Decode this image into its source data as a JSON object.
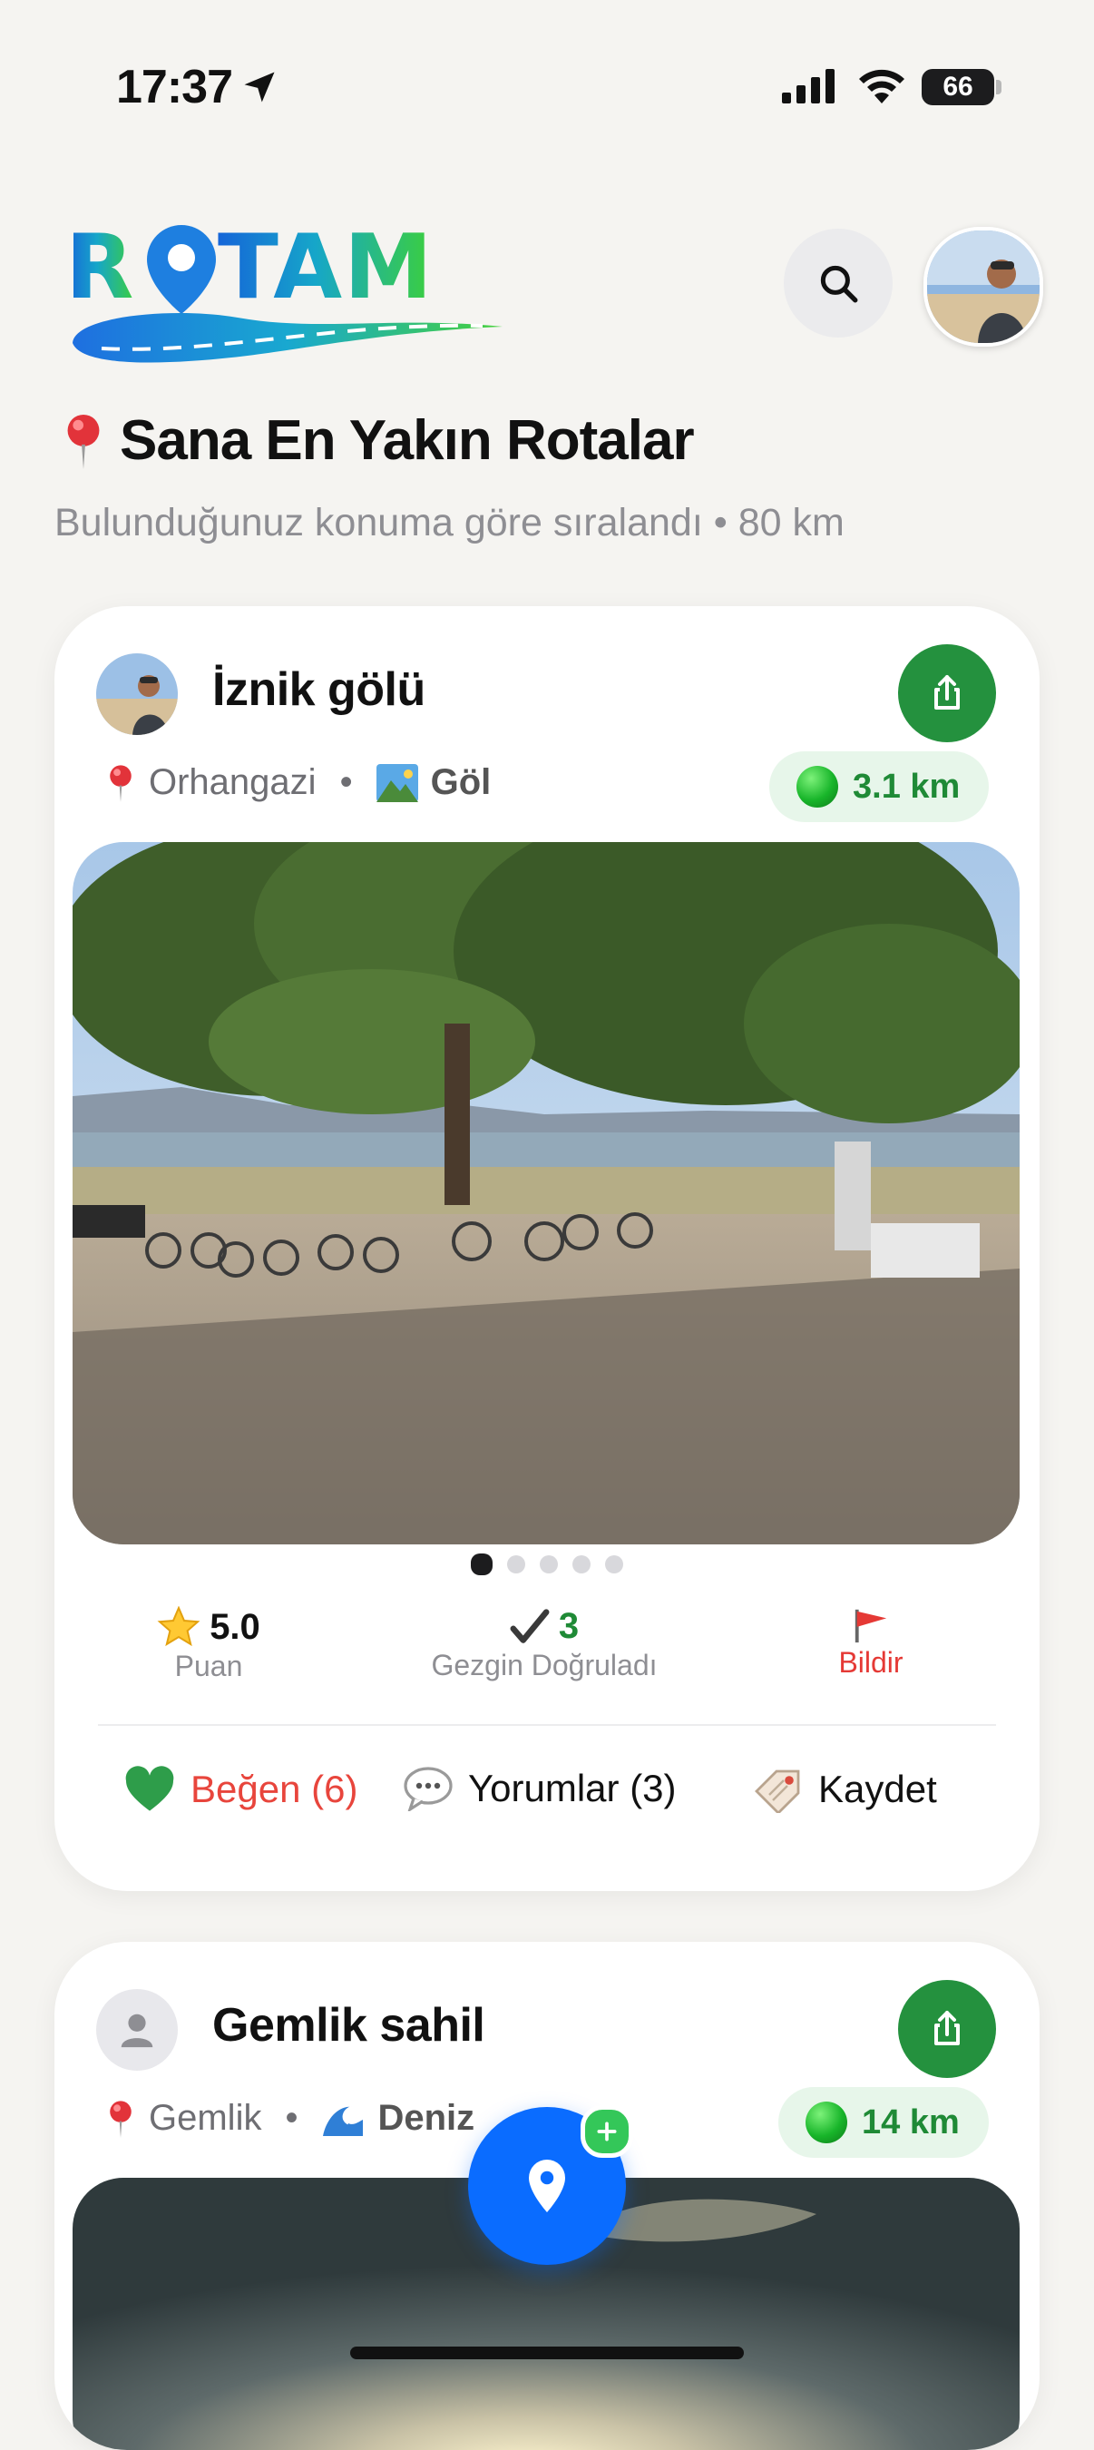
{
  "status_bar": {
    "time": "17:37",
    "battery": "66"
  },
  "header": {
    "logo_text": "ROTAM",
    "section_title": "Sana En Yakın Rotalar",
    "section_subtitle": "Bulunduğunuz konuma göre sıralandı • 80 km"
  },
  "cards": [
    {
      "title": "İznik gölü",
      "location": "Orhangazi",
      "category": "Göl",
      "category_icon": "landscape-icon",
      "distance": "3.1 km",
      "photo_count": 5,
      "active_photo": 1,
      "rating_value": "5.0",
      "rating_label": "Puan",
      "verified_value": "3",
      "verified_label": "Gezgin Doğruladı",
      "report_label": "Bildir",
      "like_label": "Beğen (6)",
      "comments_label": "Yorumlar (3)",
      "save_label": "Kaydet"
    },
    {
      "title": "Gemlik sahil",
      "location": "Gemlik",
      "category": "Deniz",
      "category_icon": "wave-icon",
      "distance": "14 km"
    }
  ],
  "colors": {
    "accent_blue": "#0a6cff",
    "green": "#24913e",
    "like_red": "#e8453c"
  }
}
